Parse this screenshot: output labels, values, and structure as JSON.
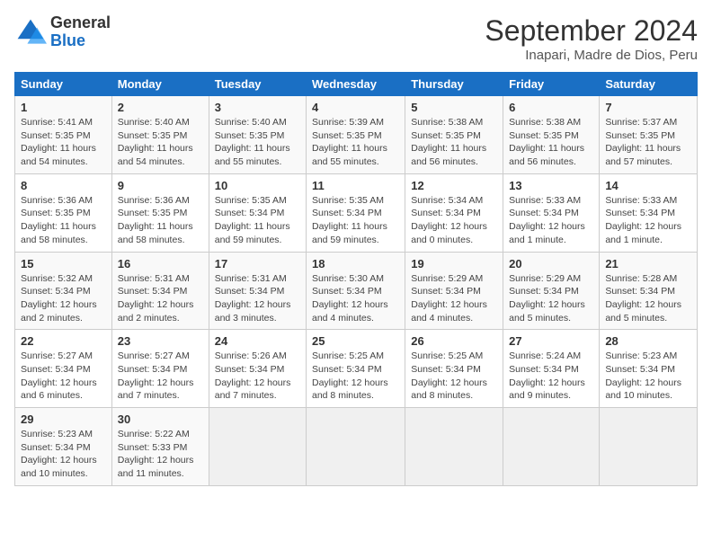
{
  "header": {
    "logo_line1": "General",
    "logo_line2": "Blue",
    "month": "September 2024",
    "location": "Inapari, Madre de Dios, Peru"
  },
  "weekdays": [
    "Sunday",
    "Monday",
    "Tuesday",
    "Wednesday",
    "Thursday",
    "Friday",
    "Saturday"
  ],
  "weeks": [
    [
      {
        "day": "1",
        "sunrise": "5:41 AM",
        "sunset": "5:35 PM",
        "daylight": "11 hours and 54 minutes."
      },
      {
        "day": "2",
        "sunrise": "5:40 AM",
        "sunset": "5:35 PM",
        "daylight": "11 hours and 54 minutes."
      },
      {
        "day": "3",
        "sunrise": "5:40 AM",
        "sunset": "5:35 PM",
        "daylight": "11 hours and 55 minutes."
      },
      {
        "day": "4",
        "sunrise": "5:39 AM",
        "sunset": "5:35 PM",
        "daylight": "11 hours and 55 minutes."
      },
      {
        "day": "5",
        "sunrise": "5:38 AM",
        "sunset": "5:35 PM",
        "daylight": "11 hours and 56 minutes."
      },
      {
        "day": "6",
        "sunrise": "5:38 AM",
        "sunset": "5:35 PM",
        "daylight": "11 hours and 56 minutes."
      },
      {
        "day": "7",
        "sunrise": "5:37 AM",
        "sunset": "5:35 PM",
        "daylight": "11 hours and 57 minutes."
      }
    ],
    [
      {
        "day": "8",
        "sunrise": "5:36 AM",
        "sunset": "5:35 PM",
        "daylight": "11 hours and 58 minutes."
      },
      {
        "day": "9",
        "sunrise": "5:36 AM",
        "sunset": "5:35 PM",
        "daylight": "11 hours and 58 minutes."
      },
      {
        "day": "10",
        "sunrise": "5:35 AM",
        "sunset": "5:34 PM",
        "daylight": "11 hours and 59 minutes."
      },
      {
        "day": "11",
        "sunrise": "5:35 AM",
        "sunset": "5:34 PM",
        "daylight": "11 hours and 59 minutes."
      },
      {
        "day": "12",
        "sunrise": "5:34 AM",
        "sunset": "5:34 PM",
        "daylight": "12 hours and 0 minutes."
      },
      {
        "day": "13",
        "sunrise": "5:33 AM",
        "sunset": "5:34 PM",
        "daylight": "12 hours and 1 minute."
      },
      {
        "day": "14",
        "sunrise": "5:33 AM",
        "sunset": "5:34 PM",
        "daylight": "12 hours and 1 minute."
      }
    ],
    [
      {
        "day": "15",
        "sunrise": "5:32 AM",
        "sunset": "5:34 PM",
        "daylight": "12 hours and 2 minutes."
      },
      {
        "day": "16",
        "sunrise": "5:31 AM",
        "sunset": "5:34 PM",
        "daylight": "12 hours and 2 minutes."
      },
      {
        "day": "17",
        "sunrise": "5:31 AM",
        "sunset": "5:34 PM",
        "daylight": "12 hours and 3 minutes."
      },
      {
        "day": "18",
        "sunrise": "5:30 AM",
        "sunset": "5:34 PM",
        "daylight": "12 hours and 4 minutes."
      },
      {
        "day": "19",
        "sunrise": "5:29 AM",
        "sunset": "5:34 PM",
        "daylight": "12 hours and 4 minutes."
      },
      {
        "day": "20",
        "sunrise": "5:29 AM",
        "sunset": "5:34 PM",
        "daylight": "12 hours and 5 minutes."
      },
      {
        "day": "21",
        "sunrise": "5:28 AM",
        "sunset": "5:34 PM",
        "daylight": "12 hours and 5 minutes."
      }
    ],
    [
      {
        "day": "22",
        "sunrise": "5:27 AM",
        "sunset": "5:34 PM",
        "daylight": "12 hours and 6 minutes."
      },
      {
        "day": "23",
        "sunrise": "5:27 AM",
        "sunset": "5:34 PM",
        "daylight": "12 hours and 7 minutes."
      },
      {
        "day": "24",
        "sunrise": "5:26 AM",
        "sunset": "5:34 PM",
        "daylight": "12 hours and 7 minutes."
      },
      {
        "day": "25",
        "sunrise": "5:25 AM",
        "sunset": "5:34 PM",
        "daylight": "12 hours and 8 minutes."
      },
      {
        "day": "26",
        "sunrise": "5:25 AM",
        "sunset": "5:34 PM",
        "daylight": "12 hours and 8 minutes."
      },
      {
        "day": "27",
        "sunrise": "5:24 AM",
        "sunset": "5:34 PM",
        "daylight": "12 hours and 9 minutes."
      },
      {
        "day": "28",
        "sunrise": "5:23 AM",
        "sunset": "5:34 PM",
        "daylight": "12 hours and 10 minutes."
      }
    ],
    [
      {
        "day": "29",
        "sunrise": "5:23 AM",
        "sunset": "5:34 PM",
        "daylight": "12 hours and 10 minutes."
      },
      {
        "day": "30",
        "sunrise": "5:22 AM",
        "sunset": "5:33 PM",
        "daylight": "12 hours and 11 minutes."
      },
      null,
      null,
      null,
      null,
      null
    ]
  ]
}
